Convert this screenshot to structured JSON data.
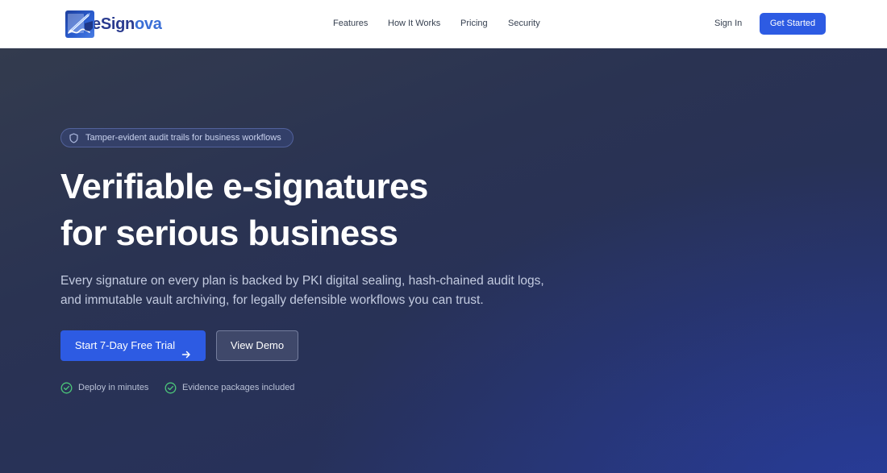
{
  "brand": {
    "logo_part1": "eSign",
    "logo_part2": "ova",
    "primary_color": "#2d5be3",
    "logo_dark_color": "#2a3b8f"
  },
  "nav": {
    "links": [
      "Features",
      "How It Works",
      "Pricing",
      "Security"
    ],
    "sign_in": "Sign In",
    "get_started": "Get Started"
  },
  "hero": {
    "badge_icon": "shield-icon",
    "badge_text": "Tamper-evident audit trails for business workflows",
    "headline_line1": "Verifiable e-signatures",
    "headline_line2": "for serious business",
    "subtext_line1": "Every signature on every plan is backed by PKI digital sealing, hash-chained audit logs,",
    "subtext_line2": "and immutable vault archiving, for legally defensible workflows you can trust.",
    "primary_cta": "Start 7-Day Free Trial",
    "primary_cta_icon": "arrow-right-icon",
    "secondary_cta": "View Demo",
    "features": [
      {
        "icon": "check-circle-icon",
        "text": "Deploy in minutes"
      },
      {
        "icon": "check-circle-icon",
        "text": "Evidence packages included"
      }
    ]
  }
}
